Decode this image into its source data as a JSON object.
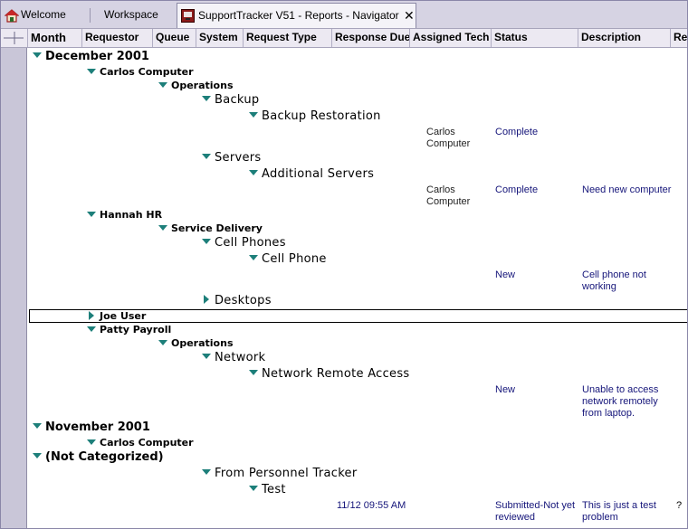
{
  "tabs": {
    "welcome": "Welcome",
    "workspace": "Workspace",
    "active": "SupportTracker V51 - Reports - Navigator",
    "close_glyph": "✕"
  },
  "columns": {
    "month": "Month",
    "requestor": "Requestor",
    "queue": "Queue",
    "system": "System",
    "request_type": "Request Type",
    "response_due": "Response Due",
    "assigned_tech": "Assigned Tech",
    "status": "Status",
    "description": "Description",
    "extra": "Re"
  },
  "tree": {
    "dec2001": "December 2001",
    "carlos": "Carlos Computer",
    "operations1": "Operations",
    "backup": "Backup",
    "backup_restoration": "Backup Restoration",
    "br_tech": "Carlos\nComputer",
    "br_status": "Complete",
    "servers": "Servers",
    "additional_servers": "Additional Servers",
    "as_tech": "Carlos\nComputer",
    "as_status": "Complete",
    "as_desc": "Need new computer",
    "hannah": "Hannah HR",
    "service_delivery": "Service Delivery",
    "cell_phones": "Cell Phones",
    "cell_phone": "Cell Phone",
    "cp_status": "New",
    "cp_desc": "Cell phone not\nworking",
    "desktops": "Desktops",
    "joe_user": "Joe User",
    "patty": "Patty Payroll",
    "operations2": "Operations",
    "network": "Network",
    "network_remote_access": "Network Remote Access",
    "nra_status": "New",
    "nra_desc": "Unable to access\nnetwork remotely\nfrom laptop.",
    "nov2001": "November 2001",
    "nov_carlos": "Carlos Computer",
    "not_categorized": "(Not Categorized)",
    "from_personnel": "From Personnel Tracker",
    "test": "Test",
    "test_due": "11/12 09:55 AM",
    "test_status": "Submitted-Not yet\nreviewed",
    "test_desc": "This is just a test\nproblem",
    "test_extra": "?"
  },
  "colors": {
    "expander": "#1d7f7a",
    "value_text": "#15157a",
    "window_bg": "#c9c6d8"
  }
}
